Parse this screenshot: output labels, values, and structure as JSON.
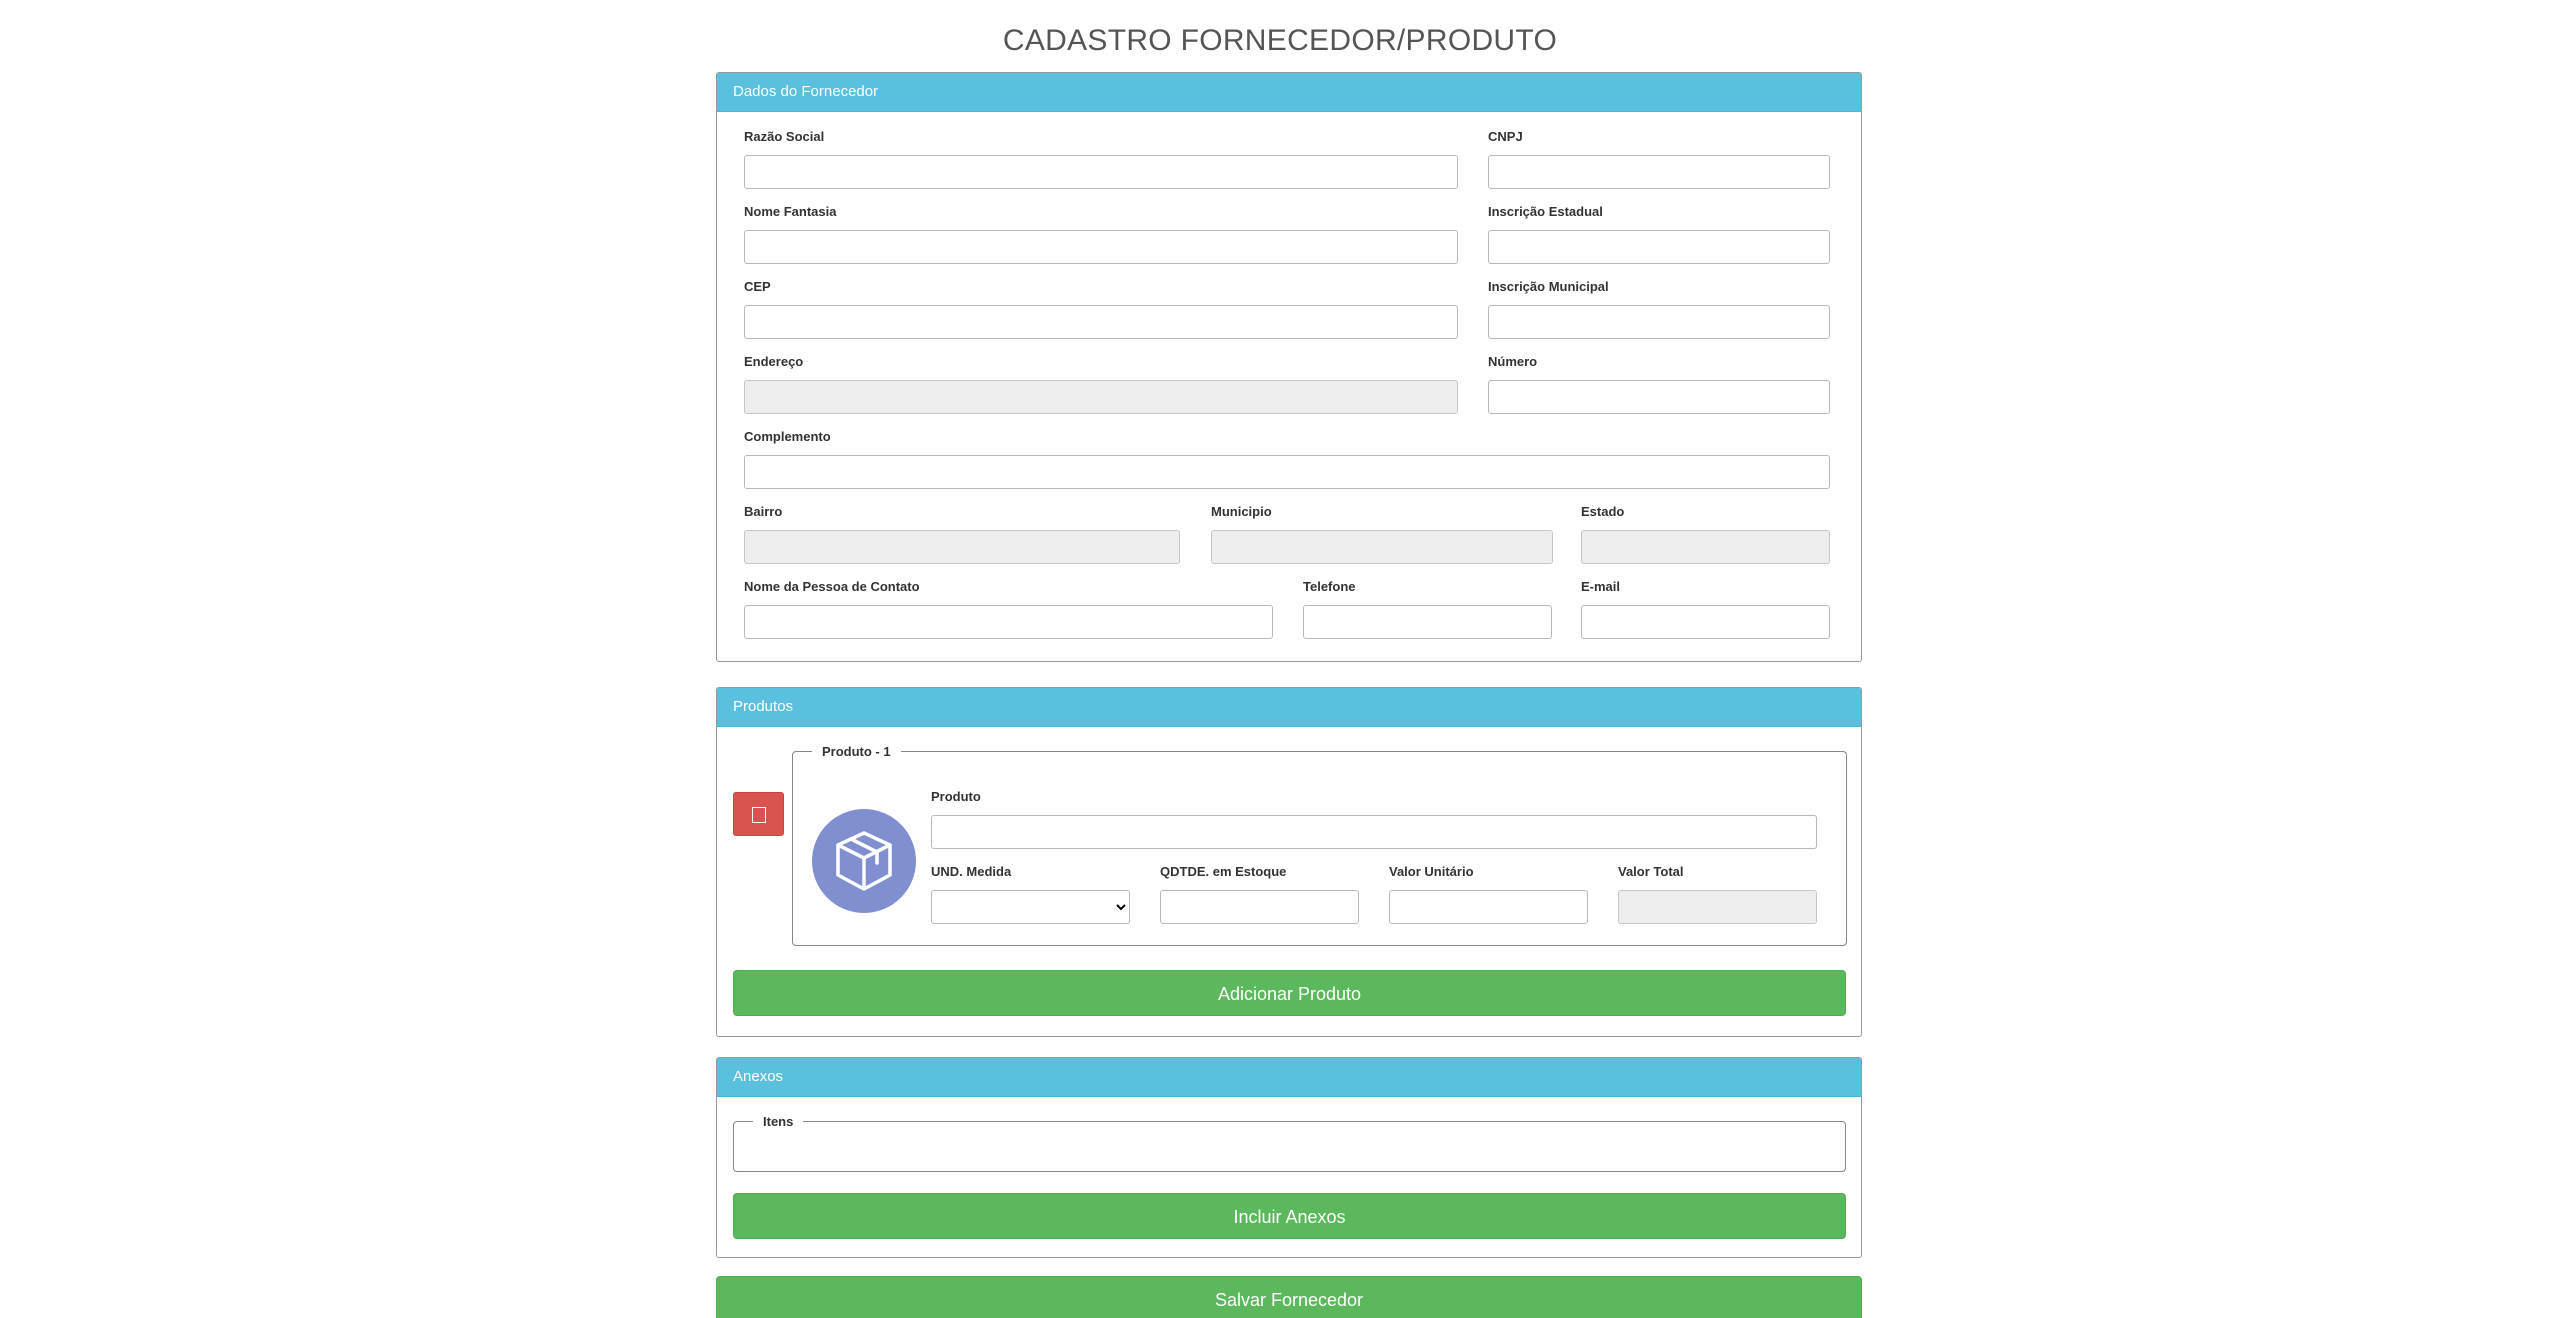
{
  "page": {
    "title": "CADASTRO FORNECEDOR/PRODUTO"
  },
  "fornecedor": {
    "heading": "Dados do Fornecedor",
    "fields": {
      "razao_social": {
        "label": "Razão Social",
        "value": ""
      },
      "cnpj": {
        "label": "CNPJ",
        "value": ""
      },
      "nome_fantasia": {
        "label": "Nome Fantasia",
        "value": ""
      },
      "inscricao_estadual": {
        "label": "Inscrição Estadual",
        "value": ""
      },
      "cep": {
        "label": "CEP",
        "value": ""
      },
      "inscricao_municipal": {
        "label": "Inscrição Municipal",
        "value": ""
      },
      "endereco": {
        "label": "Endereço",
        "value": ""
      },
      "numero": {
        "label": "Número",
        "value": ""
      },
      "complemento": {
        "label": "Complemento",
        "value": ""
      },
      "bairro": {
        "label": "Bairro",
        "value": ""
      },
      "municipio": {
        "label": "Municipio",
        "value": ""
      },
      "estado": {
        "label": "Estado",
        "value": ""
      },
      "contato": {
        "label": "Nome da Pessoa de Contato",
        "value": ""
      },
      "telefone": {
        "label": "Telefone",
        "value": ""
      },
      "email": {
        "label": "E-mail",
        "value": ""
      }
    }
  },
  "produtos": {
    "heading": "Produtos",
    "item": {
      "legend": "Produto - 1",
      "delete_icon": "trash-icon",
      "icon": "box-icon",
      "produto": {
        "label": "Produto",
        "value": ""
      },
      "und_medida": {
        "label": "UND. Medida",
        "value": ""
      },
      "qtde_estoque": {
        "label": "QDTDE. em Estoque",
        "value": ""
      },
      "valor_unitario": {
        "label": "Valor Unitário",
        "value": ""
      },
      "valor_total": {
        "label": "Valor Total",
        "value": ""
      }
    },
    "add_button": "Adicionar Produto"
  },
  "anexos": {
    "heading": "Anexos",
    "legend": "Itens",
    "add_button": "Incluir Anexos"
  },
  "save_button": "Salvar Fornecedor",
  "colors": {
    "panel_heading": "#5bc0de",
    "success": "#5cb85c",
    "danger": "#d9534f",
    "product_icon": "#7f8fcf"
  }
}
